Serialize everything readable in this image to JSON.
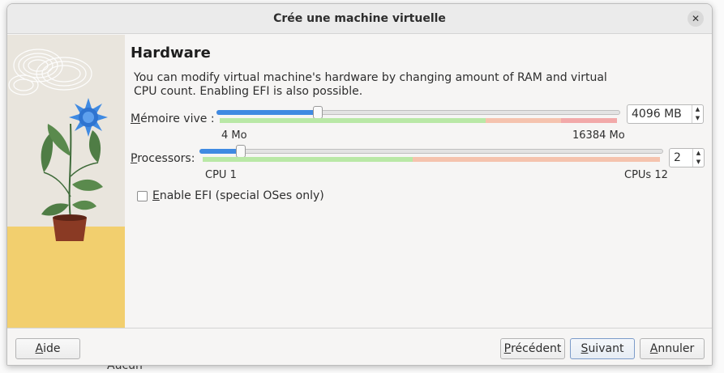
{
  "window": {
    "title": "Crée une machine virtuelle"
  },
  "page": {
    "heading": "Hardware",
    "description": "You can modify virtual machine's hardware by changing amount of RAM and virtual CPU count. Enabling EFI is also possible."
  },
  "memory": {
    "label_key": "M",
    "label_rest": "émoire vive :",
    "value": "4096 MB",
    "min_label": "4 Mo",
    "max_label": "16384 Mo",
    "fraction": 0.25
  },
  "processors": {
    "label_key": "P",
    "label_rest": "rocessors:",
    "value": "2",
    "min_label": "CPU 1",
    "max_label": "CPUs 12",
    "fraction": 0.09
  },
  "efi": {
    "label_key": "E",
    "label_rest": "nable EFI (special OSes only)",
    "checked": false
  },
  "buttons": {
    "help_key": "A",
    "help_rest": "ide",
    "back_key": "P",
    "back_rest": "récédent",
    "next_key": "S",
    "next_rest": "uivant",
    "cancel_key": "A",
    "cancel_rest": "nnuler"
  },
  "background": {
    "partial_text": "Aucun"
  },
  "colors": {
    "accent": "#3f8ae2",
    "zone_green": "#b9e8a6",
    "zone_orange": "#f5c3ae",
    "zone_red": "#f2a9a9",
    "ground": "#f2cf6e"
  }
}
